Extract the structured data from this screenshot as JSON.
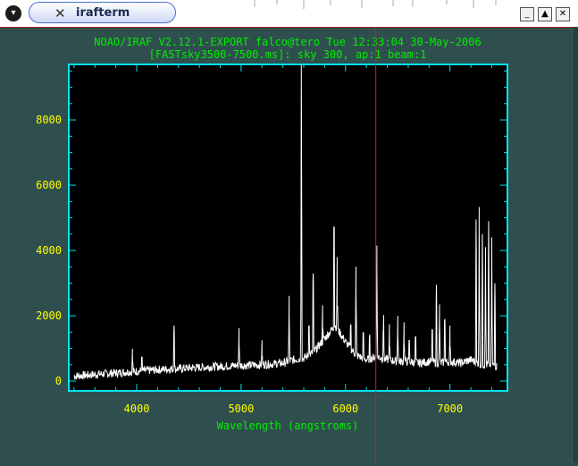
{
  "window": {
    "title": "irafterm",
    "title_icon": "x-logo-icon",
    "buttons": {
      "minimize": "_",
      "maximize": "▲",
      "close": "✕"
    }
  },
  "plot": {
    "header_line1": "NOAO/IRAF V2.12.1-EXPORT falco@tero Tue 12:33:04 30-May-2006",
    "header_line2": "[FASTsky3500-7500.ms]: sky 300, ap:1 beam:1",
    "colors": {
      "background": "#000000",
      "frame": "#00e5ee",
      "ticks": "#ffff00",
      "header": "#00ee00",
      "data": "#ffffff",
      "cursor": "#cc2222"
    }
  },
  "chart_data": {
    "type": "line",
    "title": "",
    "xlabel": "Wavelength (angstroms)",
    "ylabel": "",
    "xlim": [
      3350,
      7550
    ],
    "ylim": [
      -300,
      9700
    ],
    "xticks": [
      4000,
      5000,
      6000,
      7000
    ],
    "yticks": [
      0,
      2000,
      4000,
      6000,
      8000
    ],
    "cursor_x": 6290,
    "continuum": [
      [
        3400,
        150
      ],
      [
        3600,
        200
      ],
      [
        3800,
        250
      ],
      [
        4000,
        300
      ],
      [
        4200,
        350
      ],
      [
        4400,
        380
      ],
      [
        4600,
        420
      ],
      [
        4800,
        450
      ],
      [
        5000,
        480
      ],
      [
        5200,
        500
      ],
      [
        5400,
        550
      ],
      [
        5500,
        650
      ],
      [
        5600,
        700
      ],
      [
        5700,
        900
      ],
      [
        5800,
        1300
      ],
      [
        5900,
        1700
      ],
      [
        6000,
        1200
      ],
      [
        6100,
        800
      ],
      [
        6200,
        650
      ],
      [
        6300,
        750
      ],
      [
        6400,
        650
      ],
      [
        6500,
        600
      ],
      [
        6600,
        600
      ],
      [
        6700,
        550
      ],
      [
        6800,
        600
      ],
      [
        6900,
        550
      ],
      [
        7000,
        600
      ],
      [
        7100,
        550
      ],
      [
        7200,
        650
      ],
      [
        7300,
        500
      ],
      [
        7400,
        500
      ],
      [
        7450,
        450
      ]
    ],
    "lines": [
      [
        3960,
        700
      ],
      [
        4050,
        650
      ],
      [
        4358,
        1700
      ],
      [
        4980,
        1150
      ],
      [
        5200,
        750
      ],
      [
        5460,
        2000
      ],
      [
        5577,
        9700
      ],
      [
        5650,
        1350
      ],
      [
        5690,
        3300
      ],
      [
        5780,
        1100
      ],
      [
        5890,
        4600
      ],
      [
        5920,
        2200
      ],
      [
        6050,
        1100
      ],
      [
        6100,
        2700
      ],
      [
        6170,
        1200
      ],
      [
        6230,
        1100
      ],
      [
        6300,
        3400
      ],
      [
        6363,
        1600
      ],
      [
        6420,
        1100
      ],
      [
        6500,
        1400
      ],
      [
        6560,
        1200
      ],
      [
        6610,
        1000
      ],
      [
        6670,
        1200
      ],
      [
        6830,
        1500
      ],
      [
        6870,
        2950
      ],
      [
        6900,
        1800
      ],
      [
        6950,
        1900
      ],
      [
        7000,
        1100
      ],
      [
        7250,
        4950
      ],
      [
        7280,
        4800
      ],
      [
        7310,
        4500
      ],
      [
        7340,
        3600
      ],
      [
        7370,
        4900
      ],
      [
        7400,
        3900
      ],
      [
        7430,
        3000
      ]
    ]
  }
}
